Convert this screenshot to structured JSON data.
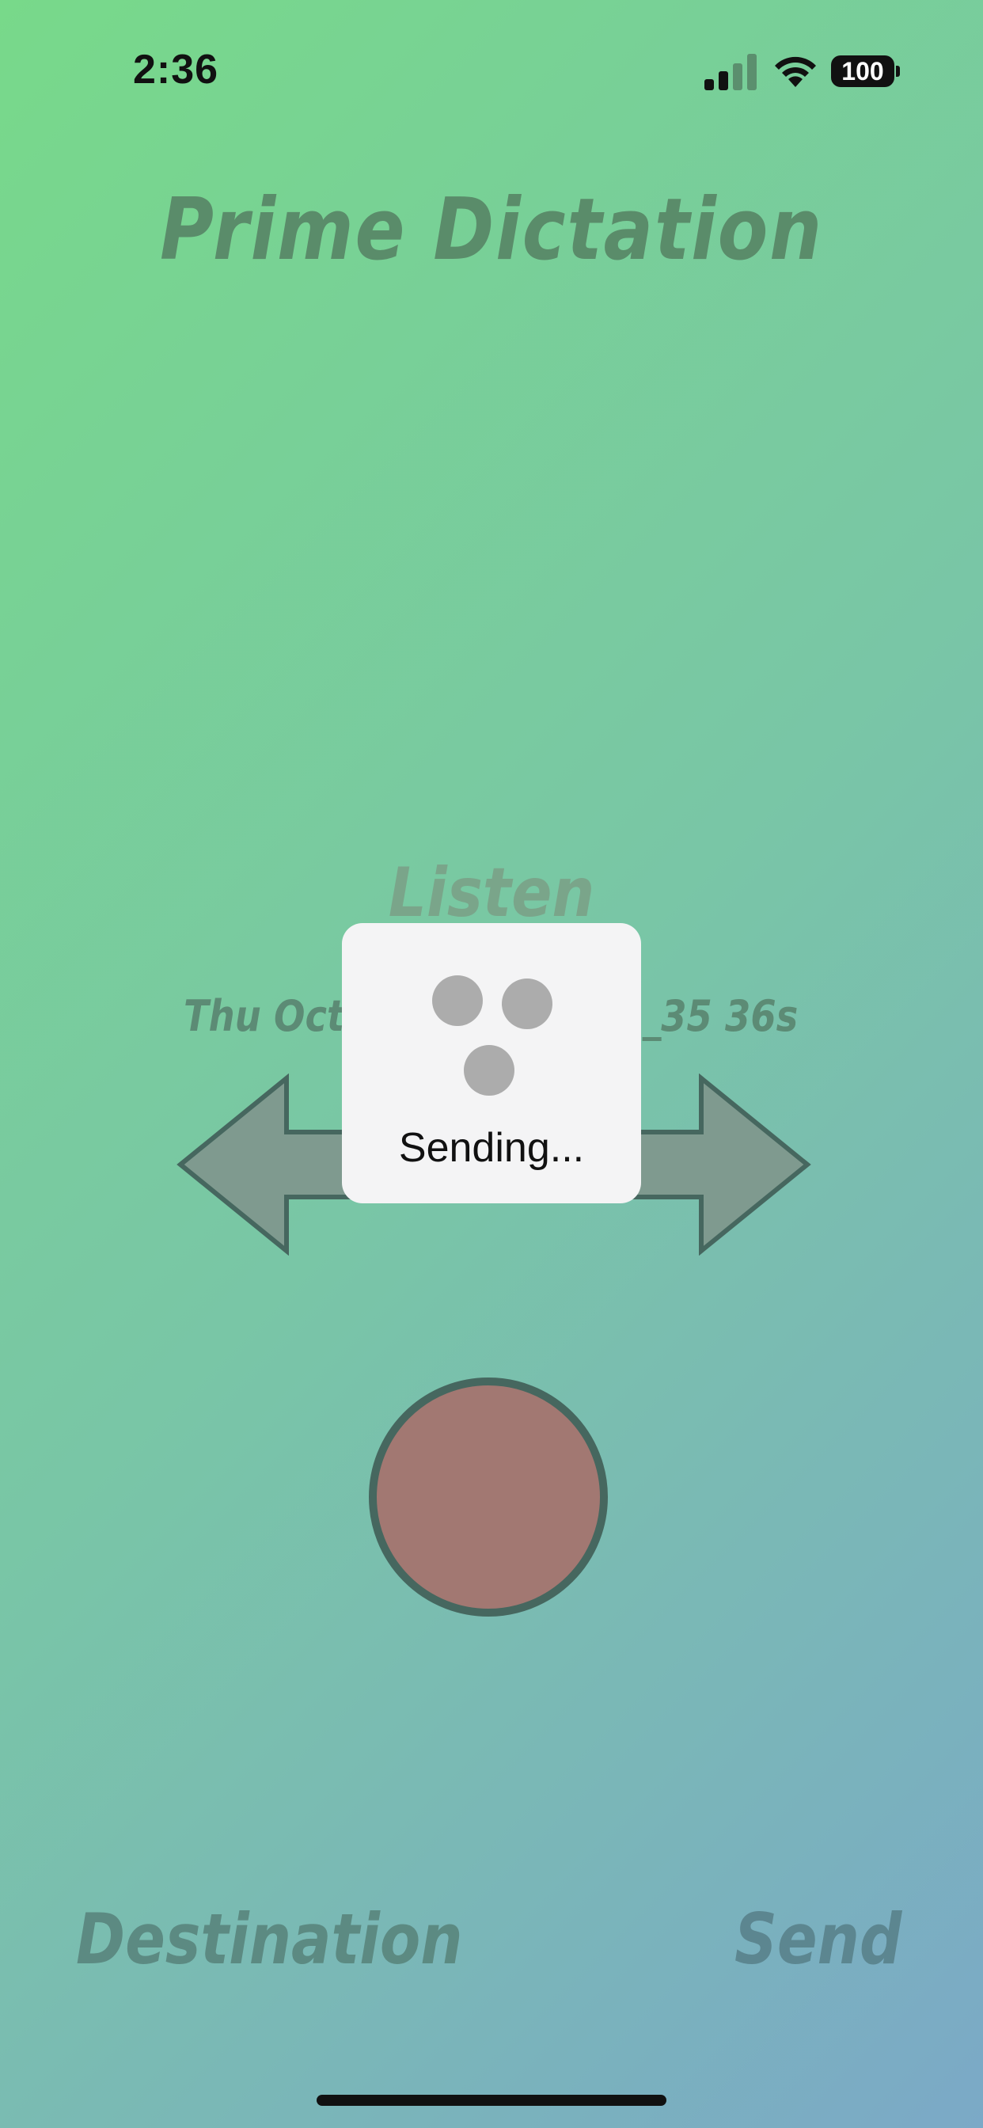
{
  "status_bar": {
    "time": "2:36",
    "battery": "100",
    "icons": [
      "cellular-signal-icon",
      "wifi-icon",
      "battery-icon"
    ]
  },
  "app": {
    "title": "Prime Dictation",
    "listen_label": "Listen",
    "recording_name_left": "Thu Oct",
    "recording_name_right": "_35 36s",
    "destination_label": "Destination",
    "send_label": "Send"
  },
  "hud": {
    "label": "Sending..."
  },
  "colors": {
    "gradient_start": "#78d98a",
    "gradient_end": "#7ba9c7",
    "record_fill": "#a27872",
    "record_border": "#46675f",
    "arrow_fill": "#7f9a8f",
    "arrow_stroke": "#46675f",
    "hud_background": "#f4f4f5"
  }
}
